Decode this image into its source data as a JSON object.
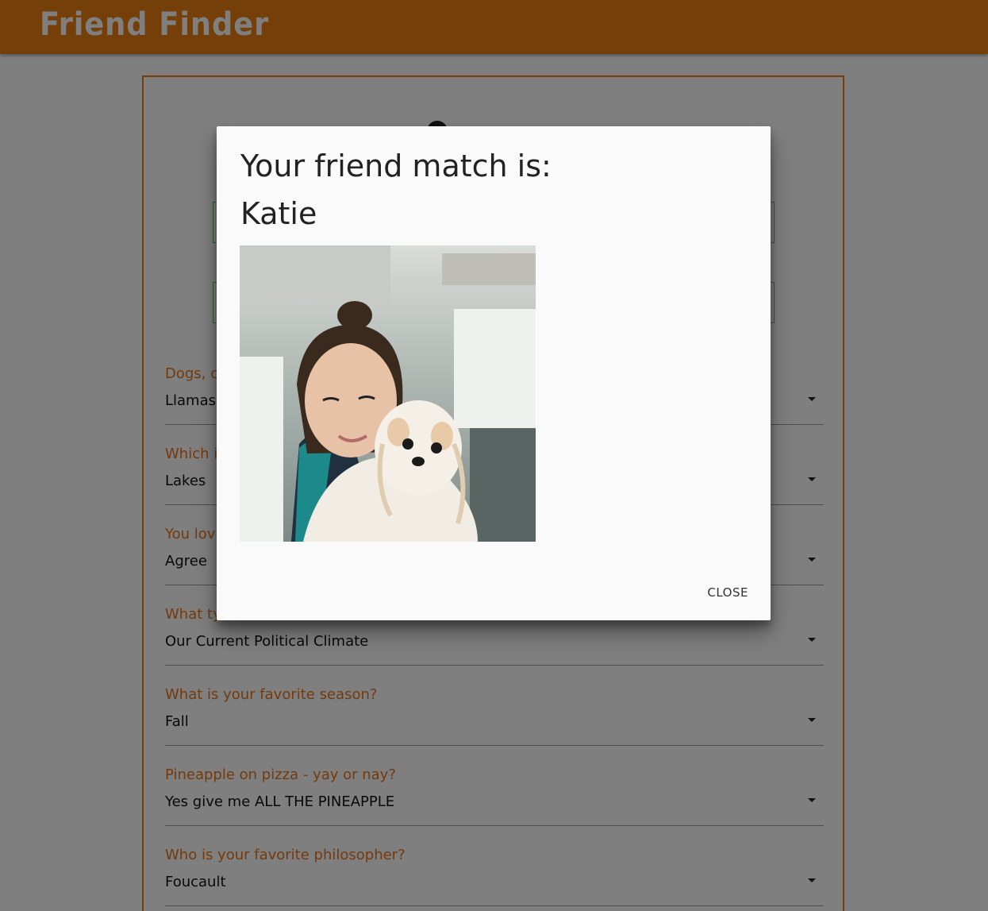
{
  "header": {
    "brand": "Friend Finder",
    "brand_color": "#e97f10"
  },
  "survey": {
    "questions": [
      {
        "label": "Dogs, c",
        "value": "Llamas"
      },
      {
        "label": "Which i",
        "value": "Lakes"
      },
      {
        "label": "You lov",
        "value": "Agree"
      },
      {
        "label": "What ty",
        "value": "Our Current Political Climate"
      },
      {
        "label": "What is your favorite season?",
        "value": "Fall"
      },
      {
        "label": "Pineapple on pizza - yay or nay?",
        "value": "Yes give me ALL THE PINEAPPLE"
      },
      {
        "label": "Who is your favorite philosopher?",
        "value": "Foucault"
      }
    ]
  },
  "modal": {
    "title": "Your friend match is:",
    "match_name": "Katie",
    "close_label": "CLOSE"
  }
}
